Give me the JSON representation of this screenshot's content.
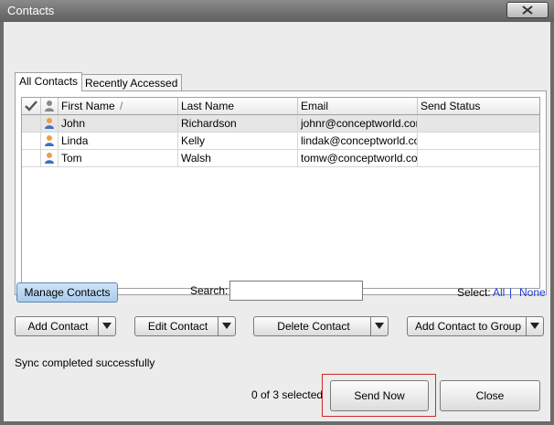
{
  "window": {
    "title": "Contacts"
  },
  "tabs": [
    {
      "label": "All Contacts",
      "active": true
    },
    {
      "label": "Recently Accessed",
      "active": false
    }
  ],
  "grid": {
    "columns": [
      "",
      "",
      "First Name",
      "Last Name",
      "Email",
      "Send Status"
    ],
    "sort_indicator": "/",
    "rows": [
      {
        "first": "John",
        "last": "Richardson",
        "email": "johnr@conceptworld.com",
        "status": ""
      },
      {
        "first": "Linda",
        "last": "Kelly",
        "email": "lindak@conceptworld.com",
        "status": ""
      },
      {
        "first": "Tom",
        "last": "Walsh",
        "email": "tomw@conceptworld.com",
        "status": ""
      }
    ]
  },
  "toolbar": {
    "manage_contacts": "Manage Contacts",
    "search_label": "Search:",
    "search_value": "",
    "select_label": "Select:",
    "select_all": "All",
    "select_sep": "|",
    "select_none": "None"
  },
  "actions": {
    "add_contact": "Add Contact",
    "edit_contact": "Edit Contact",
    "delete_contact": "Delete Contact",
    "add_to_group": "Add Contact to Group"
  },
  "footer": {
    "status": "Sync completed successfully",
    "selected_count": "0 of 3 selected",
    "send_now": "Send Now",
    "close": "Close"
  },
  "colors": {
    "accent": "#1a3dd8",
    "highlight": "#d02a2a",
    "manage_btn": "#a9cbee"
  }
}
